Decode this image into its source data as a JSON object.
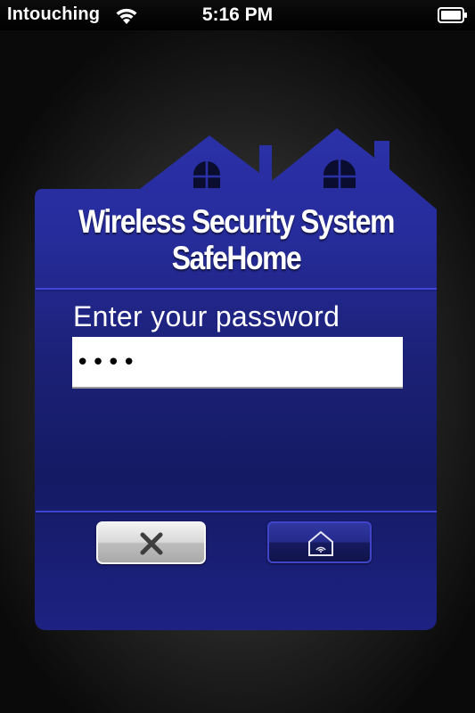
{
  "status_bar": {
    "carrier": "Intouching",
    "time": "5:16 PM",
    "wifi_icon": "wifi-icon",
    "battery_icon": "battery-icon"
  },
  "panel": {
    "title_line1": "Wireless Security System",
    "title_line2": "SafeHome",
    "password_label": "Enter your password",
    "password_value": "••••",
    "cancel_icon": "close-icon",
    "home_icon": "home-icon"
  },
  "colors": {
    "panel_blue": "#2a2f9e",
    "panel_dark": "#0d1040",
    "accent_line": "#3d44d0"
  }
}
